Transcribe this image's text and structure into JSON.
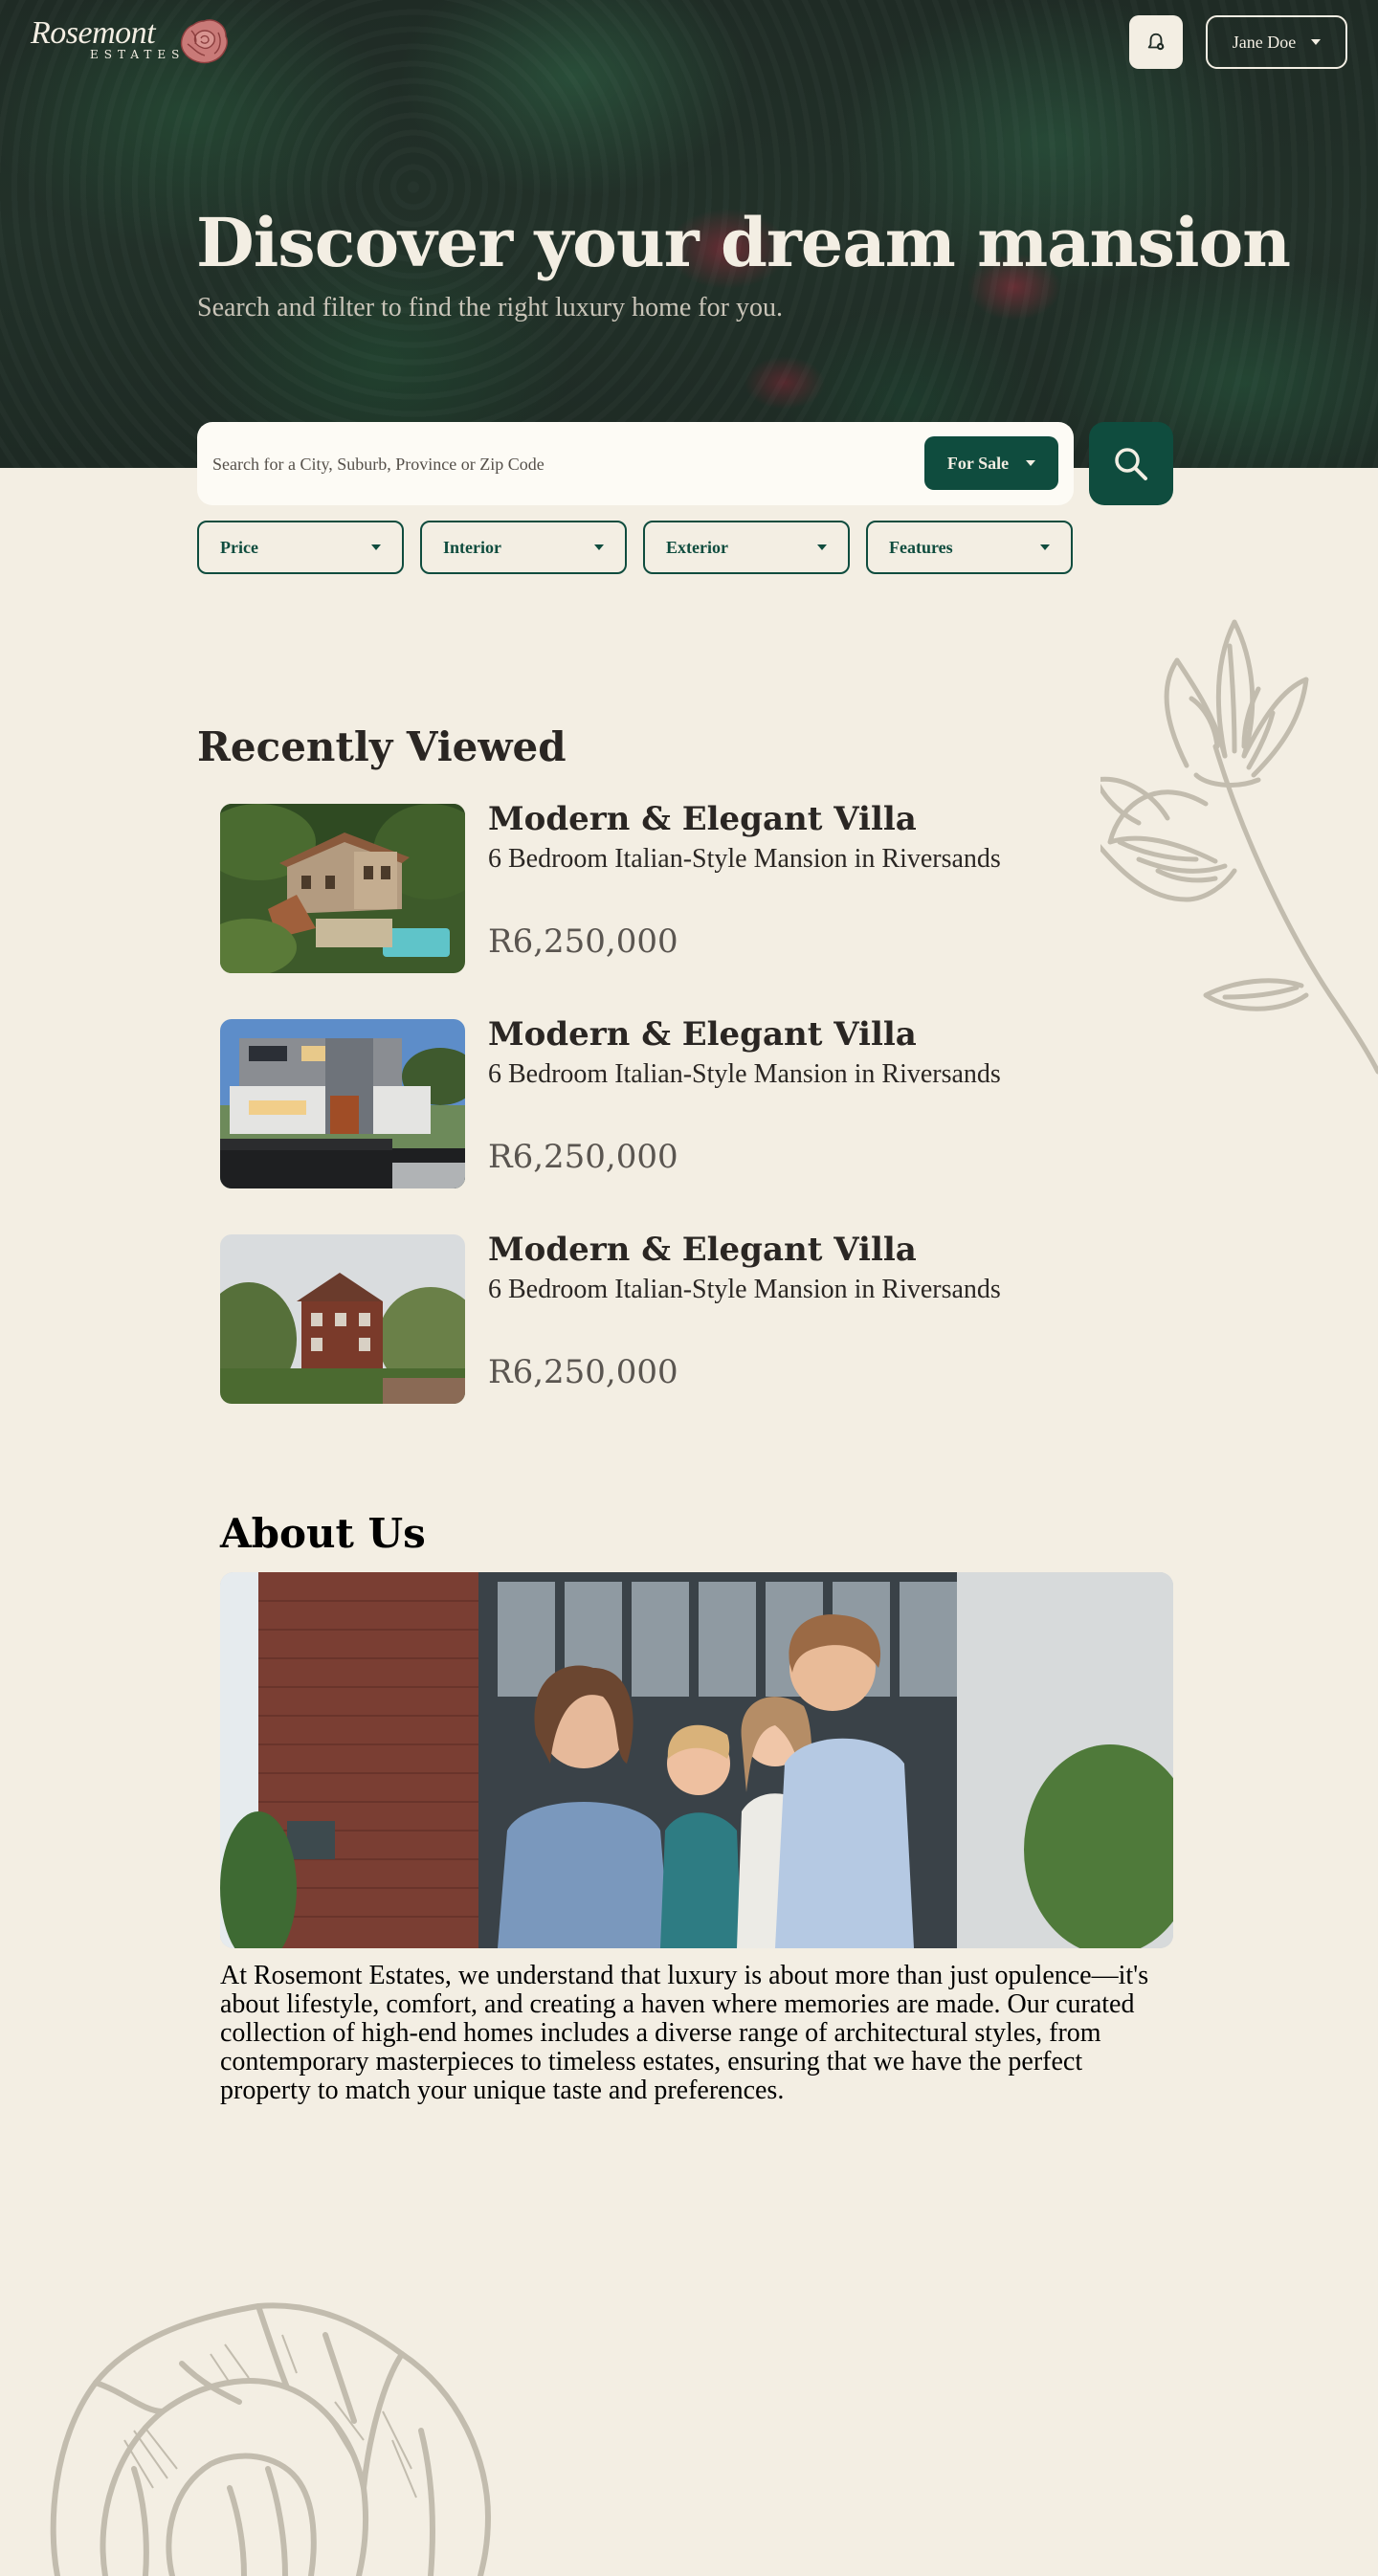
{
  "brand": {
    "name": "Rosemont",
    "tagline": "ESTATES"
  },
  "header": {
    "user_name": "Jane Doe",
    "notification_icon": "bell-icon"
  },
  "hero": {
    "title": "Discover your dream mansion",
    "subtitle": "Search and filter to find the right luxury home for you."
  },
  "search": {
    "placeholder": "Search for a City, Suburb, Province or Zip Code",
    "value": "",
    "mode": "For Sale",
    "button_icon": "search-icon"
  },
  "filters": [
    {
      "label": "Price"
    },
    {
      "label": "Interior"
    },
    {
      "label": "Exterior"
    },
    {
      "label": "Features"
    }
  ],
  "recently_viewed": {
    "title": "Recently Viewed",
    "items": [
      {
        "title": "Modern & Elegant Villa",
        "subtitle": "6 Bedroom Italian-Style Mansion in Riversands",
        "price": "R6,250,000"
      },
      {
        "title": "Modern & Elegant Villa",
        "subtitle": "6 Bedroom Italian-Style Mansion in Riversands",
        "price": "R6,250,000"
      },
      {
        "title": "Modern & Elegant Villa",
        "subtitle": "6 Bedroom Italian-Style Mansion in Riversands",
        "price": "R6,250,000"
      }
    ]
  },
  "about": {
    "title": "About Us",
    "body": "At Rosemont Estates, we understand that luxury is about more than just opulence—it's about lifestyle, comfort, and creating a haven where memories are made. Our curated collection of high-end homes includes a diverse range of architectural styles, from contemporary masterpieces to timeless estates, ensuring that we have the perfect property to match your unique taste and preferences."
  },
  "colors": {
    "primary": "#0f4c3e",
    "background": "#f3eee3",
    "hero_text": "#f3eee3",
    "decor": "#c2bcae"
  }
}
